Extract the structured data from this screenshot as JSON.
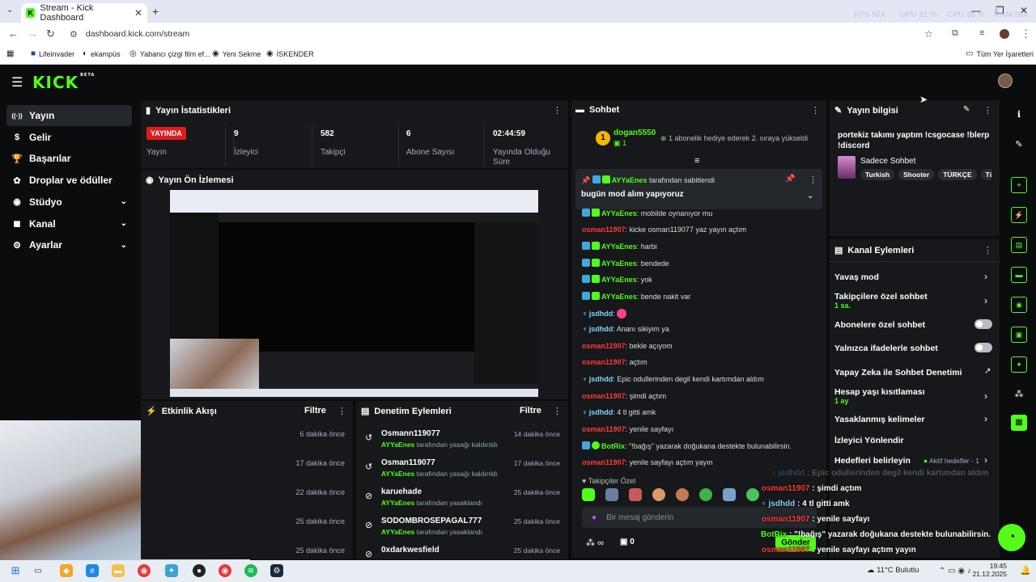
{
  "browser": {
    "tab_title": "Stream - Kick Dashboard",
    "url": "dashboard.kick.com/stream",
    "overlay_stats": [
      "FPS N/A",
      "GPU 21 %",
      "CPU 30 %",
      "RAM N/A"
    ],
    "bookmarks": [
      "Lifeinvader",
      "ekampüs",
      "Yabancı çizgi film ef...",
      "Yeni Sekme",
      "İSKENDER"
    ],
    "all_bookmarks": "Tüm Yer İşaretleri"
  },
  "sidebar": {
    "items": [
      {
        "label": "Yayın",
        "icon": "broadcast-icon",
        "active": true
      },
      {
        "label": "Gelir",
        "icon": "money-icon"
      },
      {
        "label": "Başarılar",
        "icon": "trophy-icon"
      },
      {
        "label": "Droplar ve ödüller",
        "icon": "gift-icon"
      },
      {
        "label": "Stüdyo",
        "icon": "studio-icon",
        "expandable": true
      },
      {
        "label": "Kanal",
        "icon": "channel-icon",
        "expandable": true
      },
      {
        "label": "Ayarlar",
        "icon": "gear-icon",
        "expandable": true
      }
    ]
  },
  "stats": {
    "title": "Yayın İstatistikleri",
    "live_badge": "YAYINDA",
    "live_label": "Yayın",
    "viewers": {
      "value": "9",
      "label": "İzleyici"
    },
    "followers": {
      "value": "582",
      "label": "Takipçi"
    },
    "subs": {
      "value": "6",
      "label": "Abone Sayısı"
    },
    "uptime": {
      "value": "02:44:59",
      "label": "Yayında Olduğu Süre"
    }
  },
  "preview": {
    "title": "Yayın Ön İzlemesi"
  },
  "activity": {
    "title": "Etkinlik Akışı",
    "filter": "Filtre",
    "times": [
      "6 dakika önce",
      "17 dakika önce",
      "22 dakika önce",
      "25 dakika önce",
      "25 dakika önce"
    ]
  },
  "mod": {
    "title": "Denetim Eylemleri",
    "filter": "Filtre",
    "rows": [
      {
        "name": "Osmann119077",
        "by": "AYYaEnes",
        "action": "tarafından yasağı kaldırıldı",
        "time": "14 dakika önce",
        "icon": "undo-icon"
      },
      {
        "name": "Osman119077",
        "by": "AYYaEnes",
        "action": "tarafından yasağı kaldırıldı",
        "time": "17 dakika önce",
        "icon": "undo-icon"
      },
      {
        "name": "karuehade",
        "by": "AYYaEnes",
        "action": "tarafından yasaklandı",
        "time": "25 dakika önce",
        "icon": "ban-icon"
      },
      {
        "name": "SODOMBROSEPAGAL777",
        "by": "AYYaEnes",
        "action": "tarafından yasaklandı",
        "time": "25 dakika önce",
        "icon": "ban-icon"
      },
      {
        "name": "0xdarkwesfield",
        "by": "",
        "action": "",
        "time": "25 dakika önce",
        "icon": "ban-icon"
      }
    ]
  },
  "chat": {
    "title": "Sohbet",
    "top_gifter": "dogan5550",
    "top_gifter_count": "1",
    "gift_notice": "1 abonelik hediye ederek 2. sıraya yükseldi",
    "pinned_by": "AYYaEnes",
    "pinned_suffix": "tarafından sabitlendi",
    "pinned_text": "bugün mod alım yapıyoruz",
    "messages": [
      {
        "user": "AYYaEnes",
        "color": "g",
        "text": "mobilde oynanıyor mu"
      },
      {
        "user": "osman11907",
        "color": "r",
        "text": "kicke osman119077 yaz yayın açtım"
      },
      {
        "user": "AYYaEnes",
        "color": "g",
        "text": "harbi"
      },
      {
        "user": "AYYaEnes",
        "color": "g",
        "text": "bendede"
      },
      {
        "user": "AYYaEnes",
        "color": "g",
        "text": "yok"
      },
      {
        "user": "AYYaEnes",
        "color": "g",
        "text": "bende nakit var"
      },
      {
        "user": "jsdhdd",
        "color": "b",
        "text": ""
      },
      {
        "user": "jsdhdd",
        "color": "b",
        "text": "Ananı sikiyim ya"
      },
      {
        "user": "osman11907",
        "color": "r",
        "text": "bekle açıyom"
      },
      {
        "user": "osman11907",
        "color": "r",
        "text": "açtım"
      },
      {
        "user": "jsdhdd",
        "color": "b",
        "text": "Epic odullerinden degil kendi kartımdan aldım"
      },
      {
        "user": "osman11907",
        "color": "r",
        "text": "şimdi açtım"
      },
      {
        "user": "jsdhdd",
        "color": "b",
        "text": "4 tl gitti amk"
      },
      {
        "user": "osman11907",
        "color": "r",
        "text": "yenile sayfayı"
      },
      {
        "user": "BotRix",
        "color": "g",
        "text": "\"!bağış\" yazarak doğukana destekte bulunabilirsin."
      },
      {
        "user": "osman11907",
        "color": "r",
        "text": "yenile sayfayı açtım yayın"
      }
    ],
    "followers_only": "Takipçiler Özel",
    "input_placeholder": "Bir mesaj gönderin",
    "infinity": "∞",
    "count": "0",
    "send": "Gönder"
  },
  "info": {
    "title": "Yayın bilgisi",
    "stream_title": "portekiz takımı yaptım !csgocase !blerp !discord",
    "category": "Sadece Sohbet",
    "tags": [
      "Turkish",
      "Shooter",
      "TÜRKÇE",
      "Türk"
    ]
  },
  "channel_actions": {
    "title": "Kanal Eylemleri",
    "slow": "Yavaş mod",
    "followers_only": "Takipçilere özel sohbet",
    "followers_only_sub": "1 sa.",
    "subs_only": "Abonelere özel sohbet",
    "emotes_only": "Yalnızca ifadelerle sohbet",
    "ai_mod": "Yapay Zeka ile Sohbet Denetimi",
    "age": "Hesap yaşı kısıtlaması",
    "age_sub": "1 ay",
    "banned_words": "Yasaklanmış kelimeler",
    "redirect": "İzleyici Yönlendir",
    "goals": "Hedefleri belirleyin",
    "goals_status": "Aktif hedefler - 1"
  },
  "overlay_chat": [
    {
      "user": "jsdhdd",
      "color": "b",
      "text": "Epic odullerinden degil kendi kartımdan aldım"
    },
    {
      "user": "osman11907",
      "color": "r",
      "text": "şimdi açtım"
    },
    {
      "user": "jsdhdd",
      "color": "b",
      "text": "4 tl gitti amk"
    },
    {
      "user": "osman11907",
      "color": "r",
      "text": "yenile sayfayı"
    },
    {
      "user": "BotRix",
      "color": "g",
      "text": "\"!bağış\" yazarak doğukana destekte bulunabilirsin."
    },
    {
      "user": "osman11907",
      "color": "r",
      "text": "yenile sayfayı açtım yayın"
    }
  ],
  "taskbar": {
    "weather": "11°C  Bulutlu",
    "time": "19:45",
    "date": "21.12.2025"
  }
}
